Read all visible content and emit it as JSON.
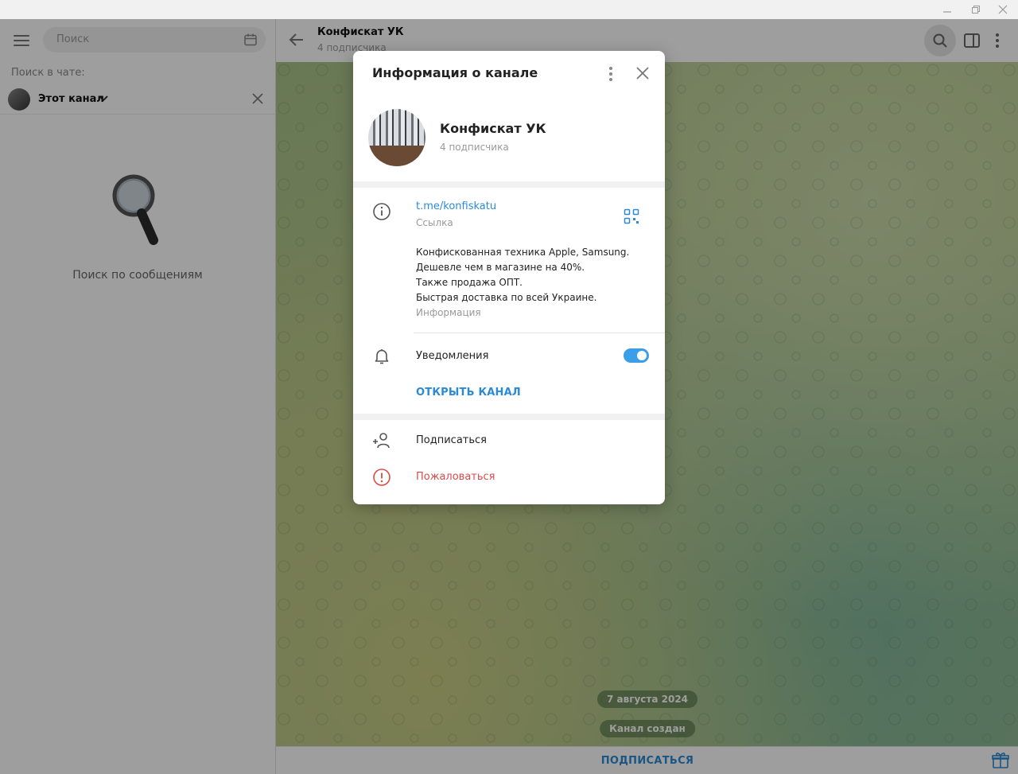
{
  "left": {
    "search_placeholder": "Поиск",
    "in_chat_label": "Поиск в чате:",
    "scope_label": "Этот канал",
    "empty_text": "Поиск по сообщениям"
  },
  "chat": {
    "title": "Конфискат УК",
    "subtitle": "4 подписчика",
    "date_pill": "7 августа 2024",
    "created_pill": "Канал создан",
    "subscribe_button": "ПОДПИСАТЬСЯ"
  },
  "modal": {
    "title": "Информация о канале",
    "channel_name": "Конфискат УК",
    "subscribers": "4 подписчика",
    "link": "t.me/konfiskatu",
    "link_label": "Ссылка",
    "description_lines": [
      "Конфискованная техника Apple, Samsung.",
      "Дешевле чем в магазине на 40%.",
      "Также продажа ОПТ.",
      "Быстрая доставка по всей Украине."
    ],
    "description_label": "Информация",
    "notifications_label": "Уведомления",
    "notifications_on": true,
    "open_channel": "ОТКРЫТЬ КАНАЛ",
    "subscribe": "Подписаться",
    "report": "Пожаловаться"
  },
  "colors": {
    "accent": "#2b8ad6",
    "danger": "#d94b4b",
    "toggle": "#3b9ee8"
  }
}
